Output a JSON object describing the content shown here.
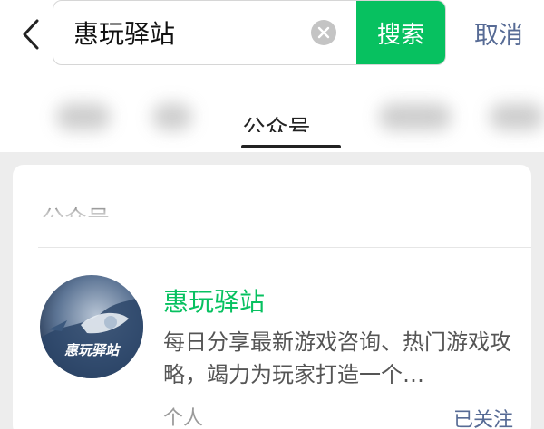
{
  "search": {
    "value": "惠玩驿站",
    "button_label": "搜索",
    "cancel_label": "取消"
  },
  "tabs": {
    "active_label": "公众号"
  },
  "section": {
    "title": "公众号"
  },
  "account": {
    "name": "惠玩驿站",
    "avatar_text": "惠玩驿站",
    "description": "每日分享最新游戏咨询、热门游戏攻略，竭力为玩家打造一个…",
    "type": "个人",
    "follow_status": "已关注"
  },
  "colors": {
    "accent": "#07c160",
    "link": "#576b95",
    "background": "#ededed"
  }
}
